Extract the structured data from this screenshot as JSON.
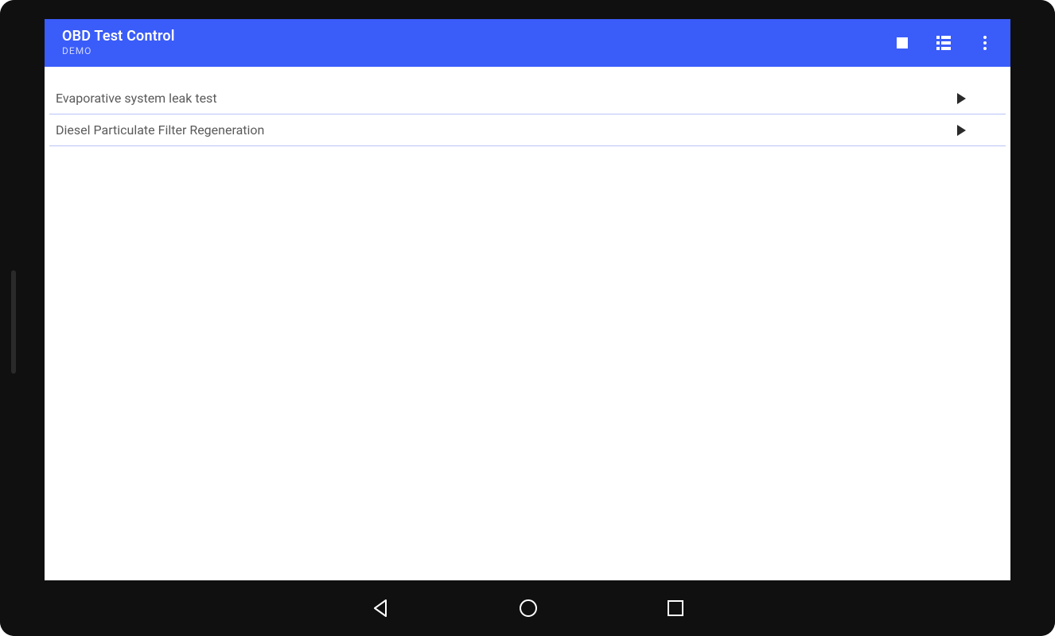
{
  "colors": {
    "primary": "#3a5cf9",
    "row_divider": "#b9c4f7"
  },
  "app_bar": {
    "title": "OBD Test Control",
    "subtitle": "DEMO",
    "actions": {
      "stop": "stop",
      "view_list": "view-list",
      "overflow": "more"
    }
  },
  "tests": [
    {
      "label": "Evaporative system leak test"
    },
    {
      "label": "Diesel Particulate Filter Regeneration"
    }
  ],
  "nav": {
    "back": "back",
    "home": "home",
    "recent": "recent-apps"
  }
}
